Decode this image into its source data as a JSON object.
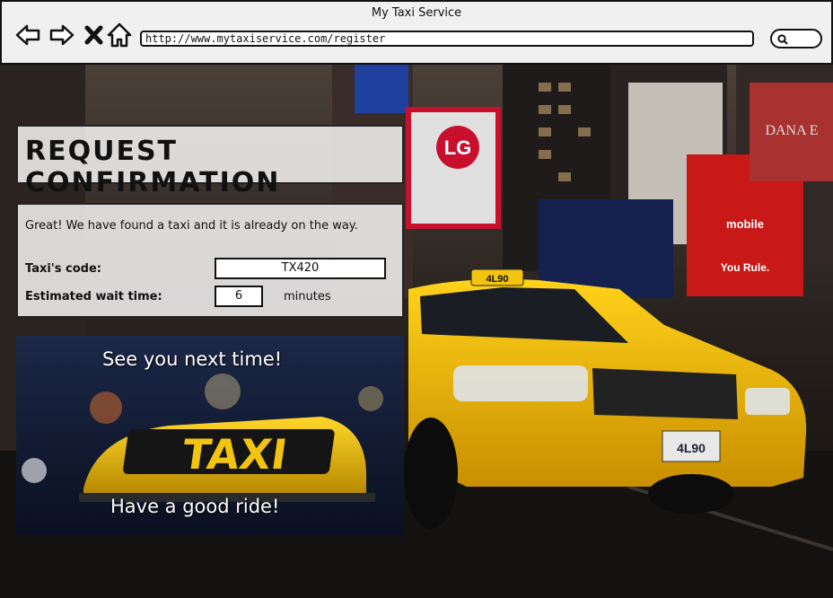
{
  "window": {
    "title": "My Taxi Service"
  },
  "toolbar": {
    "url": "http://www.mytaxiservice.com/register",
    "icons": [
      "back-arrow-icon",
      "forward-arrow-icon",
      "close-icon",
      "home-icon",
      "search-icon"
    ]
  },
  "page": {
    "title": "REQUEST CONFIRMATION",
    "message": "Great! We have found a taxi and it is already on the way.",
    "taxi_code_label": "Taxi's code:",
    "taxi_code_value": "TX420",
    "wait_label": "Estimated wait time:",
    "wait_value": "6",
    "wait_unit": "minutes"
  },
  "banner": {
    "top_text": "See you next time!",
    "bottom_text": "Have a good ride!",
    "sign_text": "TAXI"
  },
  "background": {
    "billboards": [
      "LG",
      "mobile",
      "You Rule.",
      "DANA E"
    ],
    "cab_roof_number": "4L90",
    "plate": "4L90"
  },
  "colors": {
    "taxi_yellow": "#f2c40f",
    "chrome": "#f0f0f0"
  }
}
